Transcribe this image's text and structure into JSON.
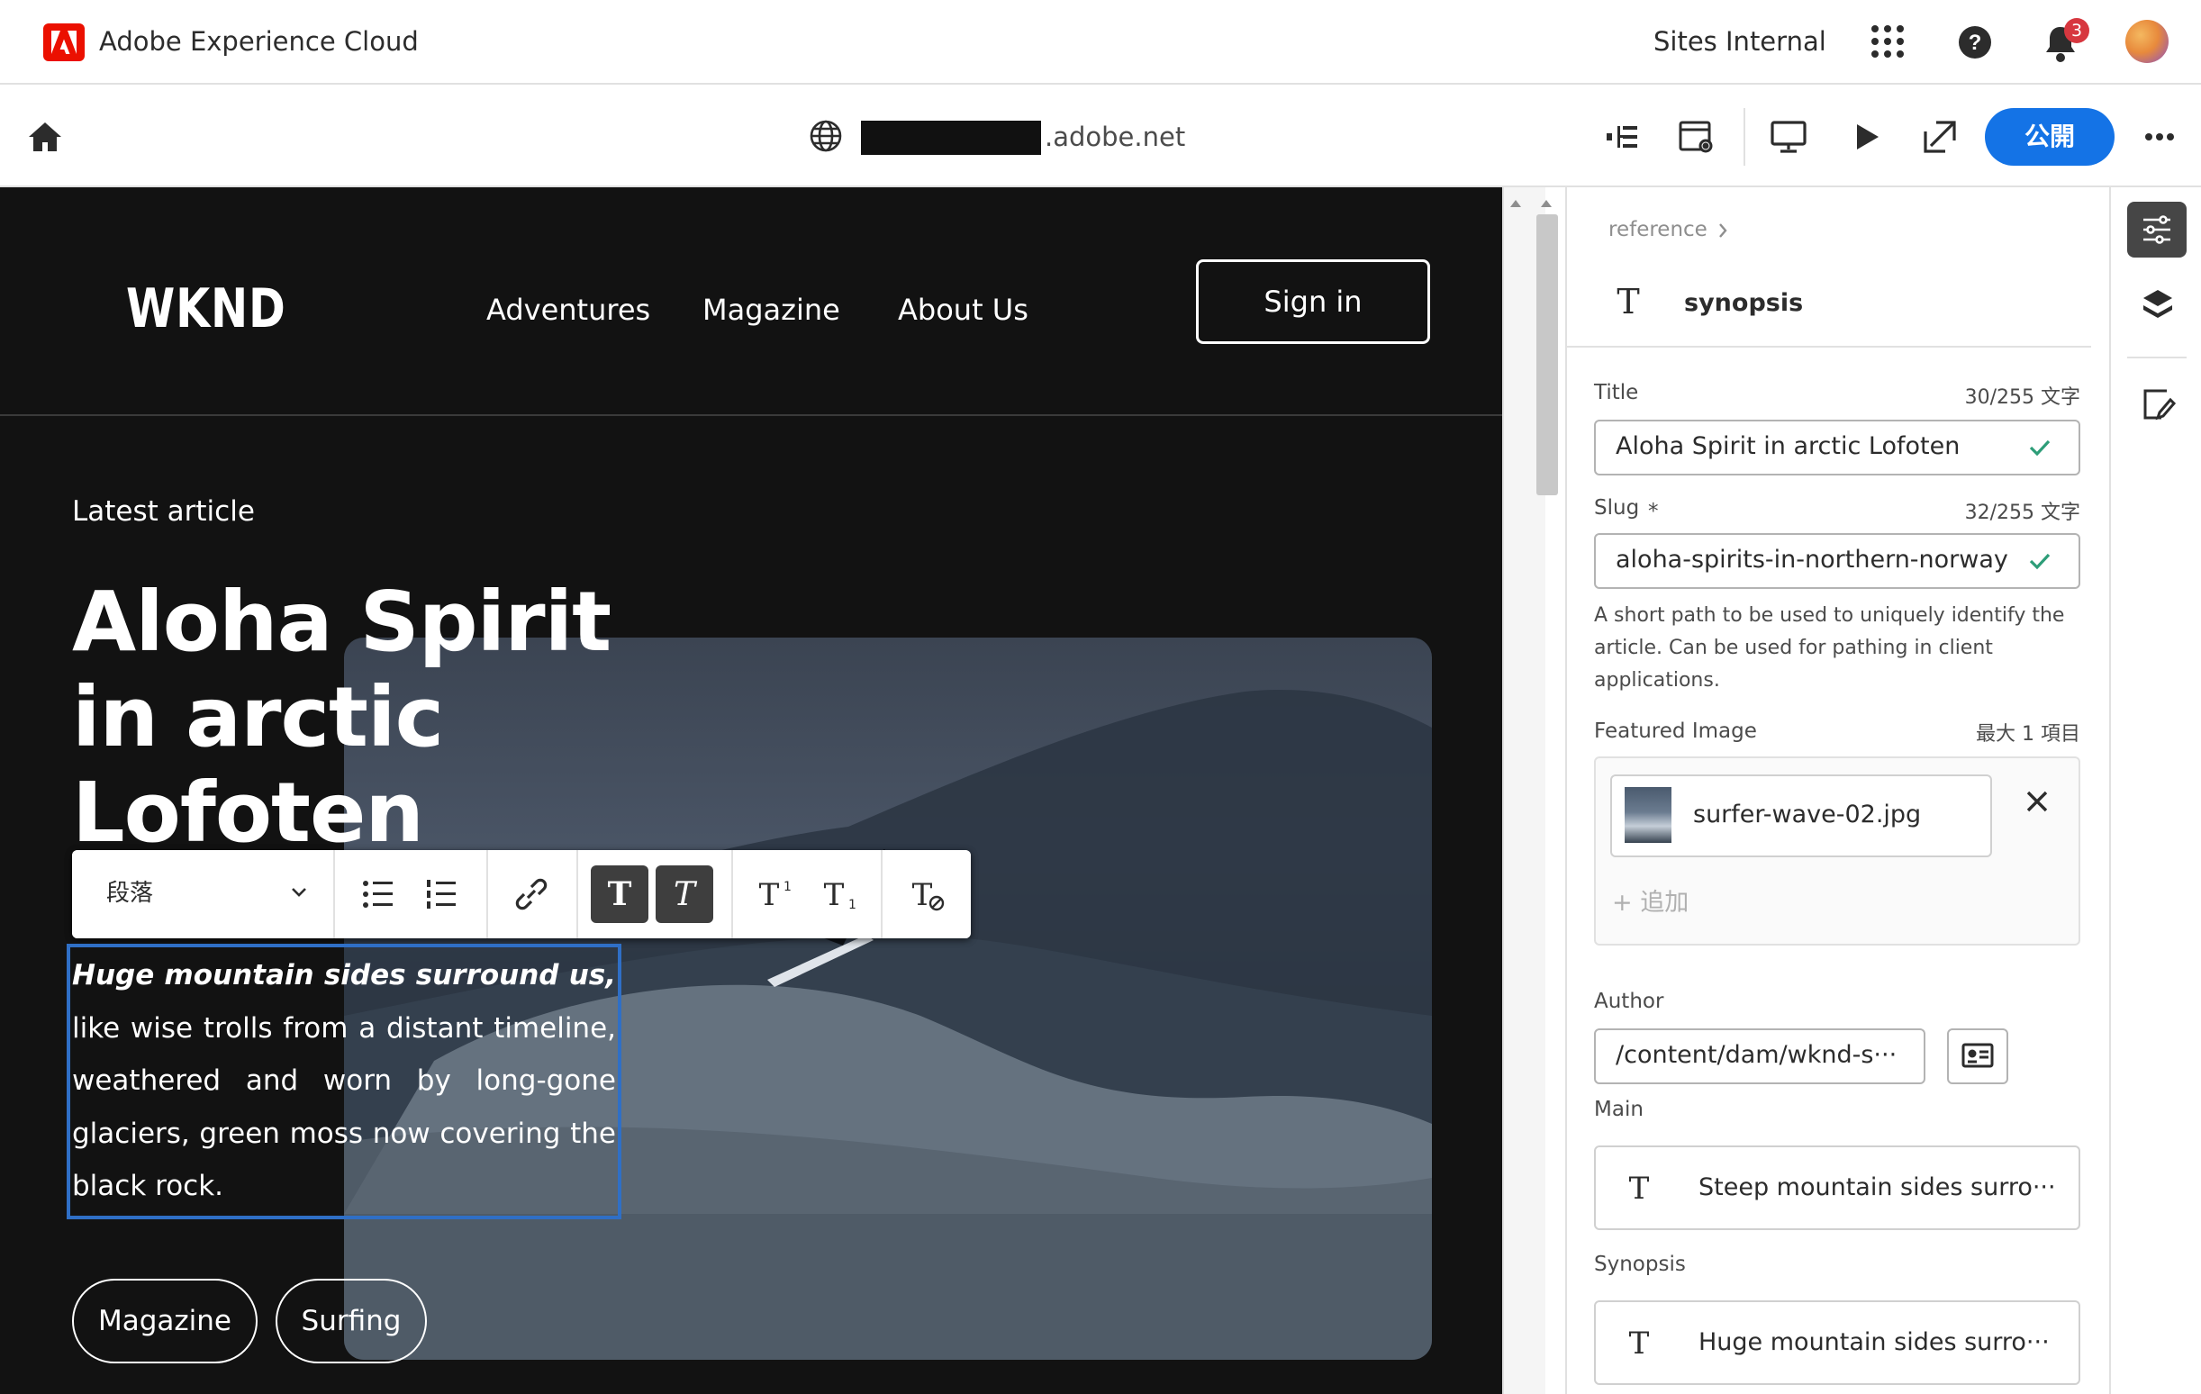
{
  "app": {
    "title": "Adobe Experience Cloud",
    "org": "Sites Internal",
    "notification_count": "3"
  },
  "editor": {
    "url_suffix": ".adobe.net",
    "publish_label": "公開"
  },
  "site": {
    "logo": "WKND",
    "nav": [
      "Adventures",
      "Magazine",
      "About Us"
    ],
    "signin_label": "Sign in",
    "eyebrow": "Latest article",
    "headline": "Aloha Spirit in arctic Lofoten",
    "synopsis_bold": "Huge mountain sides surround us,",
    "synopsis_rest": " like wise trolls from a distant timeline, weathered and worn by long-gone glaciers, green moss now covering the black rock.",
    "tags": [
      "Magazine",
      "Surfing"
    ]
  },
  "rte": {
    "paragraph_format": "段落",
    "buttons": [
      "bulleted-list",
      "numbered-list",
      "link",
      "bold",
      "italic",
      "superscript",
      "subscript",
      "clear-format"
    ],
    "active": [
      "bold",
      "italic"
    ]
  },
  "panel": {
    "breadcrumb": "reference",
    "component_name": "synopsis",
    "title_label": "Title",
    "title_count": "30/255 文字",
    "title_value": "Aloha Spirit in arctic Lofoten",
    "slug_label": "Slug",
    "slug_required": "*",
    "slug_count": "32/255 文字",
    "slug_value": "aloha-spirits-in-northern-norway",
    "slug_help": "A short path to be used to uniquely identify the article. Can be used for pathing in client applications.",
    "featured_label": "Featured Image",
    "featured_max": "最大 1 項目",
    "featured_file": "surfer-wave-02.jpg",
    "add_label": "+ 追加",
    "author_label": "Author",
    "author_value": "/content/dam/wknd-s···",
    "main_label": "Main",
    "main_value": "Steep mountain sides surro···",
    "synopsis_label": "Synopsis",
    "synopsis_value": "Huge mountain sides surro···"
  },
  "colors": {
    "accent": "#1473e6",
    "selection": "#2f6fc6",
    "adobe_red": "#eb1000",
    "badge": "#d7373f",
    "valid": "#2d9d78"
  }
}
